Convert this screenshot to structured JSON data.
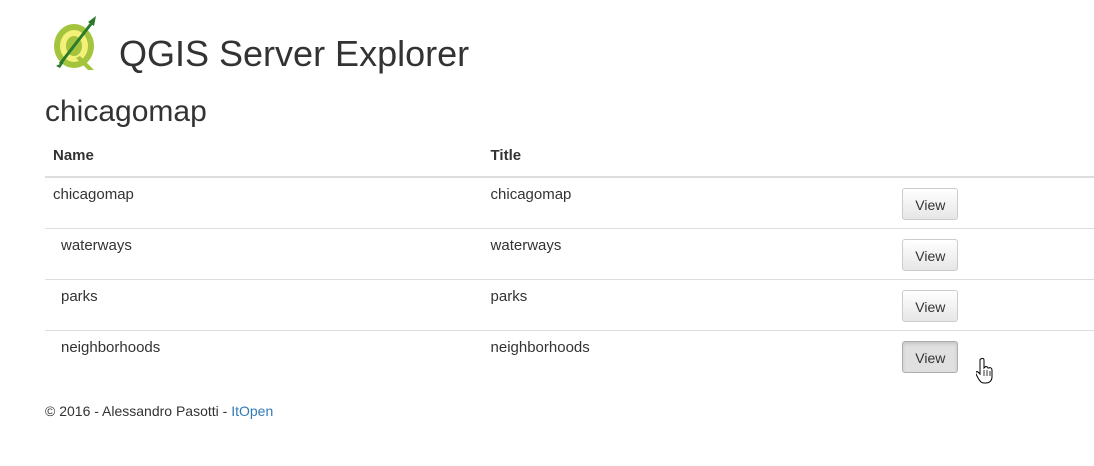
{
  "header": {
    "logo_icon": "qgis-logo-icon",
    "title": "QGIS Server Explorer"
  },
  "project": {
    "title": "chicagomap"
  },
  "table": {
    "columns": [
      "Name",
      "Title",
      ""
    ],
    "rows": [
      {
        "name": "chicagomap",
        "title": "chicagomap",
        "action": "View"
      },
      {
        "name": "waterways",
        "title": "waterways",
        "action": "View"
      },
      {
        "name": "parks",
        "title": "parks",
        "action": "View"
      },
      {
        "name": "neighborhoods",
        "title": "neighborhoods",
        "action": "View"
      }
    ]
  },
  "footer": {
    "copyright": "© 2016 - Alessandro Pasotti - ",
    "link_text": "ItOpen",
    "link_color": "#337ab7"
  }
}
